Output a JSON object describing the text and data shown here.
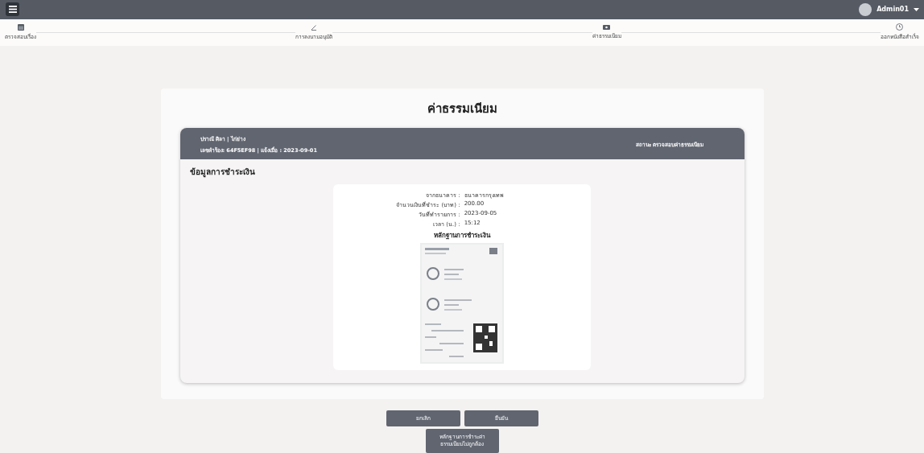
{
  "topbar": {
    "user": "Admin01"
  },
  "steps": [
    {
      "label": "ตรวจสอบเรื่อง",
      "kind": "calendar"
    },
    {
      "label": "การลงนามอนุมัติ",
      "kind": "pen"
    },
    {
      "label": "ค่าธรรมเนียม",
      "kind": "money"
    },
    {
      "label": "ออกหนังสือสำเร็จ",
      "kind": "clock"
    }
  ],
  "title": "ค่าธรรมเนียม",
  "request": {
    "name": "ปราณี ศิลา | ไก่ย่าง",
    "number": "เลขคำร้อง: 64F5EF98 | แจ้งเมื่อ : 2023-09-01",
    "status": "สถานะ ตรวจสอบค่าธรรมเนียม"
  },
  "section_title": "ข้อมูลการชำระเงิน",
  "payment": [
    {
      "label": "จากธนาคาร :",
      "value": "ธนาคารกรุงเทพ"
    },
    {
      "label": "จำนวนเงินที่ชำระ (บาท) :",
      "value": "200.00"
    },
    {
      "label": "วันที่ทำรายการ :",
      "value": "2023-09-05"
    },
    {
      "label": "เวลา (น.) :",
      "value": "15:12"
    }
  ],
  "evidence_title": "หลักฐานการชำระเงิน",
  "buttons": [
    "ยกเลิก",
    "ยืนยัน"
  ],
  "reject_button": "หลักฐานการชำระค่าธรรมเนียมไม่ถูกต้อง"
}
